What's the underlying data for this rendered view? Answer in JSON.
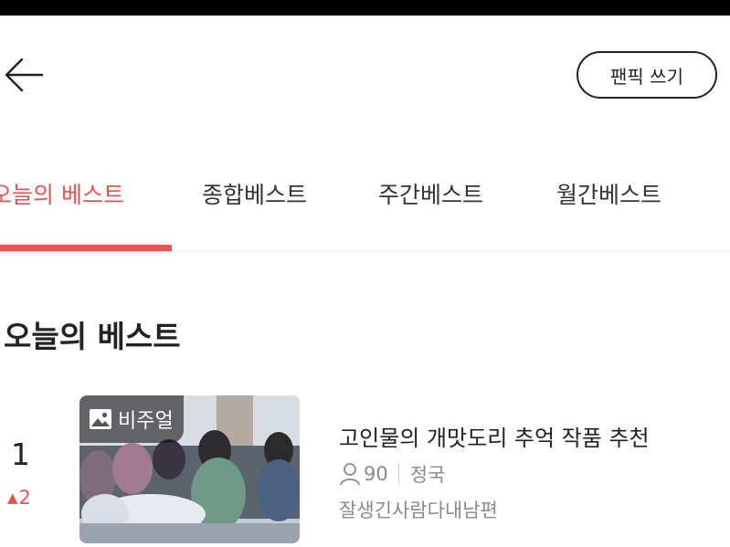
{
  "header": {
    "back_icon": "arrow-left-icon",
    "write_button_label": "팬픽 쓰기"
  },
  "tabs": [
    {
      "label": "오늘의 베스트",
      "active": true
    },
    {
      "label": "종합베스트",
      "active": false
    },
    {
      "label": "주간베스트",
      "active": false
    },
    {
      "label": "월간베스트",
      "active": false
    }
  ],
  "section": {
    "title": "오늘의 베스트"
  },
  "items": [
    {
      "rank": "1",
      "rank_change": "2",
      "rank_change_icon": "triangle-up-icon",
      "badge_label": "비주얼",
      "badge_icon": "image-icon",
      "title": "고인물의 개맛도리 추억 작품 추천",
      "participants_icon": "person-icon",
      "participants": "90",
      "category": "정국",
      "author": "잘생긴사람다내남편"
    }
  ],
  "colors": {
    "accent": "#e9534e",
    "text": "#222222",
    "muted": "#8a8a8a"
  }
}
